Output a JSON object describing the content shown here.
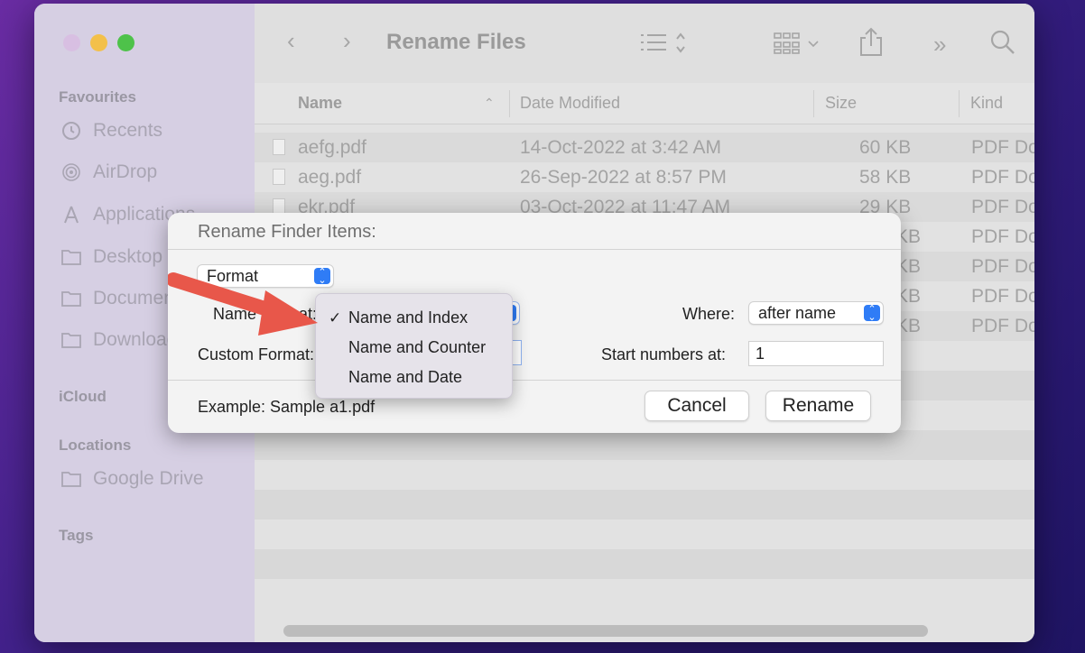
{
  "window": {
    "title": "Rename Files"
  },
  "sidebar": {
    "sections": {
      "favourites": "Favourites",
      "icloud": "iCloud",
      "locations": "Locations",
      "tags": "Tags"
    },
    "items": [
      {
        "label": "Recents",
        "icon": "clock-icon"
      },
      {
        "label": "AirDrop",
        "icon": "airdrop-icon"
      },
      {
        "label": "Applications",
        "icon": "applications-icon"
      },
      {
        "label": "Desktop",
        "icon": "folder-icon"
      },
      {
        "label": "Documents",
        "icon": "folder-icon"
      },
      {
        "label": "Downloads",
        "icon": "folder-icon"
      }
    ],
    "locations": [
      {
        "label": "Google Drive",
        "icon": "folder-icon"
      }
    ]
  },
  "columns": {
    "name": "Name",
    "date": "Date Modified",
    "size": "Size",
    "kind": "Kind"
  },
  "files": [
    {
      "name": "aefg.pdf",
      "date": "14-Oct-2022 at 3:42 AM",
      "size": "60 KB",
      "kind": "PDF Document"
    },
    {
      "name": "aeg.pdf",
      "date": "26-Sep-2022 at 8:57 PM",
      "size": "58 KB",
      "kind": "PDF Document"
    },
    {
      "name": "ekr.pdf",
      "date": "03-Oct-2022 at 11:47 AM",
      "size": "29 KB",
      "kind": "PDF Document"
    },
    {
      "name": "",
      "date": "",
      "size": "KB",
      "kind": "PDF Document"
    },
    {
      "name": "",
      "date": "",
      "size": "KB",
      "kind": "PDF Document"
    },
    {
      "name": "",
      "date": "",
      "size": "KB",
      "kind": "PDF Document"
    },
    {
      "name": "",
      "date": "",
      "size": "KB",
      "kind": "PDF Document"
    }
  ],
  "dialog": {
    "title": "Rename Finder Items:",
    "mode_value": "Format",
    "name_format_label": "Name Format:",
    "custom_format_label": "Custom Format:",
    "where_label": "Where:",
    "where_value": "after name",
    "start_numbers_label": "Start numbers at:",
    "start_numbers_value": "1",
    "example": "Example: Sample a1.pdf",
    "cancel": "Cancel",
    "rename": "Rename"
  },
  "menu": {
    "items": [
      "Name and Index",
      "Name and Counter",
      "Name and Date"
    ],
    "selected": "Name and Index",
    "check": "✓"
  },
  "colors": {
    "accent": "#2f7cf6",
    "arrow": "#e8574a"
  }
}
